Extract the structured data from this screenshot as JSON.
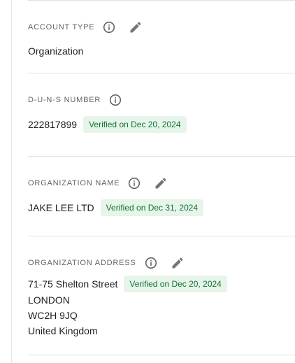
{
  "account_type": {
    "label": "ACCOUNT TYPE",
    "value": "Organization",
    "info_icon": "info-icon",
    "edit_icon": "pencil-icon"
  },
  "duns": {
    "label": "D-U-N-S NUMBER",
    "value": "222817899",
    "badge": "Verified on Dec 20, 2024",
    "info_icon": "info-icon"
  },
  "org_name": {
    "label": "ORGANIZATION NAME",
    "value": "JAKE LEE LTD",
    "badge": "Verified on Dec 31, 2024",
    "info_icon": "info-icon",
    "edit_icon": "pencil-icon"
  },
  "org_address": {
    "label": "ORGANIZATION ADDRESS",
    "lines": [
      "71-75 Shelton Street",
      "LONDON",
      "WC2H 9JQ",
      "United Kingdom"
    ],
    "badge": "Verified on Dec 20, 2024",
    "info_icon": "info-icon",
    "edit_icon": "pencil-icon"
  },
  "colors": {
    "badge_bg": "#e6f4ea",
    "badge_text": "#137333",
    "label_text": "#5f6368",
    "icon": "#5f6368",
    "divider": "#e0e0e0"
  }
}
